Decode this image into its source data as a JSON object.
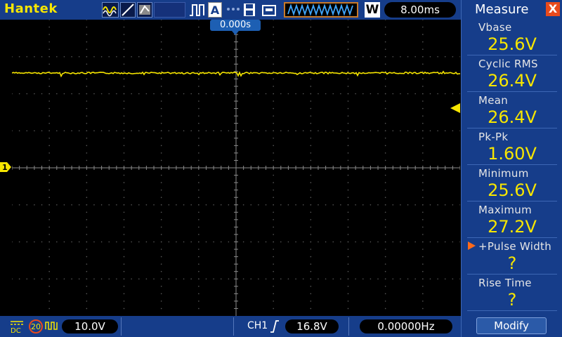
{
  "header": {
    "brand": "Hantek",
    "timebase": "8.00ms",
    "buffer_mode_icon": "waveform-buffer-icon",
    "w_label": "W",
    "a_label": "A"
  },
  "screen": {
    "trigger_position": "0.000s",
    "channel_marker": "1",
    "trace_color": "#f7e600",
    "grid_color": "#5a5a5a"
  },
  "footer": {
    "coupling": "DC",
    "bandwidth_limit": "20",
    "ch1_scale": "10.0V",
    "trigger_source": "CH1",
    "trigger_level": "16.8V",
    "frequency": "0.00000Hz"
  },
  "measure_panel": {
    "title": "Measure",
    "close_label": "X",
    "items": [
      {
        "label": "Vbase",
        "value": "25.6V"
      },
      {
        "label": "Cyclic RMS",
        "value": "26.4V"
      },
      {
        "label": "Mean",
        "value": "26.4V"
      },
      {
        "label": "Pk-Pk",
        "value": "1.60V"
      },
      {
        "label": "Minimum",
        "value": "25.6V"
      },
      {
        "label": "Maximum",
        "value": "27.2V"
      },
      {
        "label": "+Pulse Width",
        "value": "?"
      },
      {
        "label": "Rise Time",
        "value": "?"
      }
    ],
    "modify_label": "Modify"
  },
  "colors": {
    "bar_blue": "#163d8a",
    "accent_yellow": "#f7e600",
    "close_red": "#e84a1c",
    "select_orange": "#ff6a1a"
  }
}
